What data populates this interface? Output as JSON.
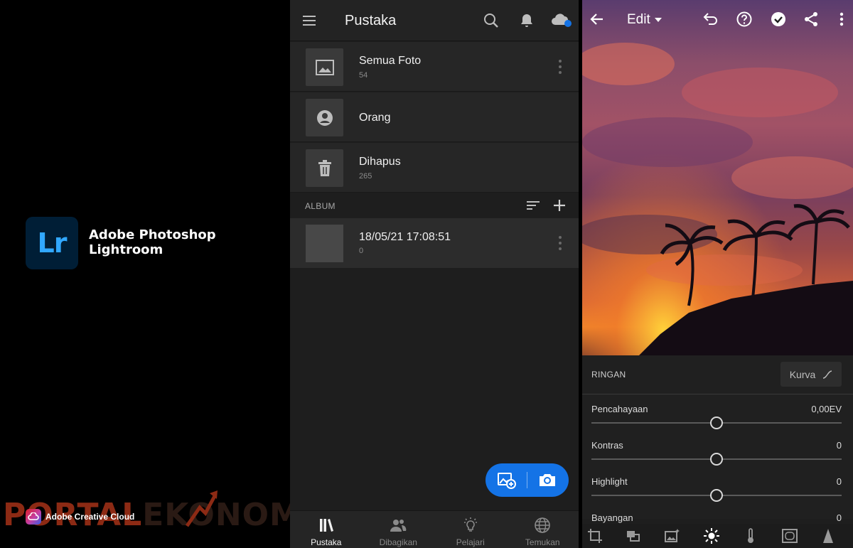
{
  "splash": {
    "logo_text": "Lr",
    "app_name_line1": "Adobe Photoshop",
    "app_name_line2": "Lightroom",
    "creative_cloud_label": "Adobe Creative Cloud",
    "watermark_part1": "PORTAL",
    "watermark_part2": "EKONOMI"
  },
  "library": {
    "title": "Pustaka",
    "rows": [
      {
        "title": "Semua Foto",
        "count": "54",
        "icon": "image-icon"
      },
      {
        "title": "Orang",
        "count": "",
        "icon": "person-icon"
      },
      {
        "title": "Dihapus",
        "count": "265",
        "icon": "trash-icon"
      }
    ],
    "album_section_label": "ALBUM",
    "album": {
      "title": "18/05/21 17:08:51",
      "count": "0"
    },
    "nav": [
      {
        "label": "Pustaka",
        "icon": "library-icon",
        "active": true
      },
      {
        "label": "Dibagikan",
        "icon": "people-icon",
        "active": false
      },
      {
        "label": "Pelajari",
        "icon": "lightbulb-icon",
        "active": false
      },
      {
        "label": "Temukan",
        "icon": "globe-icon",
        "active": false
      }
    ],
    "accent_color": "#1473e6"
  },
  "edit": {
    "mode_label": "Edit",
    "section_label": "RINGAN",
    "curve_button_label": "Kurva",
    "sliders": [
      {
        "label": "Pencahayaan",
        "value": "0,00EV",
        "position": 0.5
      },
      {
        "label": "Kontras",
        "value": "0",
        "position": 0.5
      },
      {
        "label": "Highlight",
        "value": "0",
        "position": 0.5
      },
      {
        "label": "Bayangan",
        "value": "0",
        "position": 0.5
      }
    ],
    "tools": [
      "crop-icon",
      "presets-icon",
      "auto-icon",
      "light-icon",
      "color-icon",
      "effects-icon",
      "detail-icon"
    ]
  }
}
